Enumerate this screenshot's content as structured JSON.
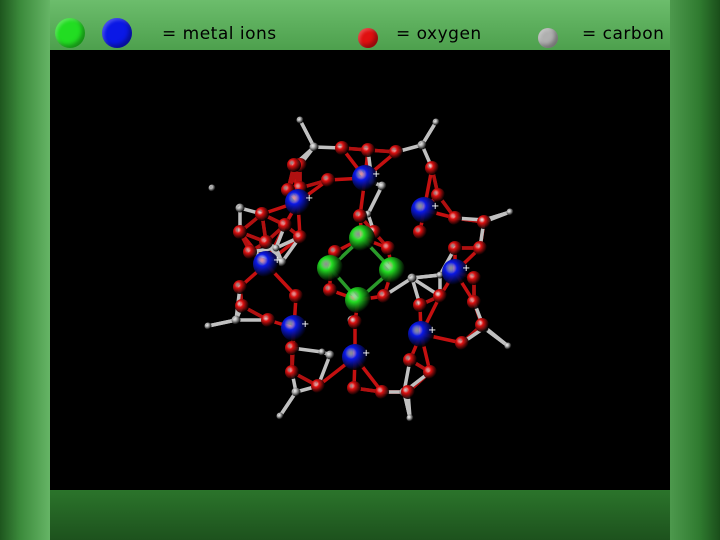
{
  "legend": {
    "metal_label": "= metal ions",
    "oxygen_label": "= oxygen",
    "carbon_label": "= carbon"
  },
  "colors": {
    "metal_green": "#22dd22",
    "metal_blue": "#0a18e6",
    "oxygen": "#e01010",
    "carbon": "#b8b8b8",
    "background": "#000000",
    "frame": "#3d8a3d"
  },
  "molecule": {
    "description_markers": [
      "+",
      "+",
      "+",
      "+",
      "+",
      "+",
      "+",
      "+"
    ]
  }
}
